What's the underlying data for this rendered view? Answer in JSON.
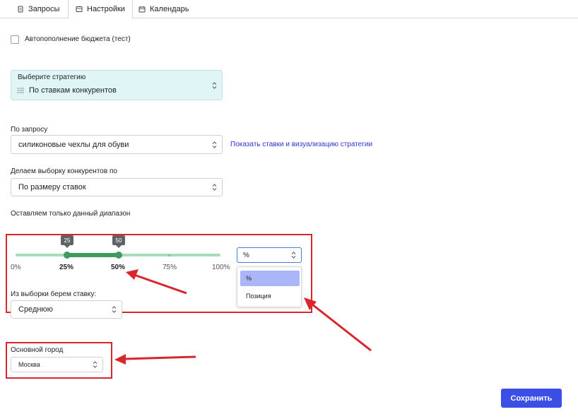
{
  "tabs": [
    {
      "label": "Запросы",
      "icon": "document-icon"
    },
    {
      "label": "Настройки",
      "icon": "settings-icon",
      "active": true
    },
    {
      "label": "Календарь",
      "icon": "calendar-icon"
    }
  ],
  "autofill": {
    "label": "Автопополнение бюджета (тест)",
    "checked": false
  },
  "strategy": {
    "caption": "Выберите стратегию",
    "value": "По ставкам конкурентов"
  },
  "query": {
    "label": "По запросу",
    "value": "силиконовые чехлы для обуви",
    "link": "Показать ставки и визуализацию стратегии"
  },
  "competitors": {
    "label": "Делаем выборку конкурентов по",
    "value": "По размеру ставок"
  },
  "range": {
    "label": "Оставляем только данный диапазон",
    "low": 25,
    "high": 50,
    "low_tip": "25",
    "high_tip": "50",
    "ticks": [
      "0%",
      "25%",
      "50%",
      "75%",
      "100%"
    ],
    "unit_value": "%",
    "unit_options": [
      "%",
      "Позиция"
    ]
  },
  "bid": {
    "label": "Из выборки берем ставку:",
    "value": "Среднюю"
  },
  "city": {
    "label": "Основной город",
    "value": "Москва"
  },
  "save_label": "Сохранить",
  "colors": {
    "accent": "#3b4ee6",
    "annotation": "#d9262c",
    "slider": "#3e9b5e"
  }
}
